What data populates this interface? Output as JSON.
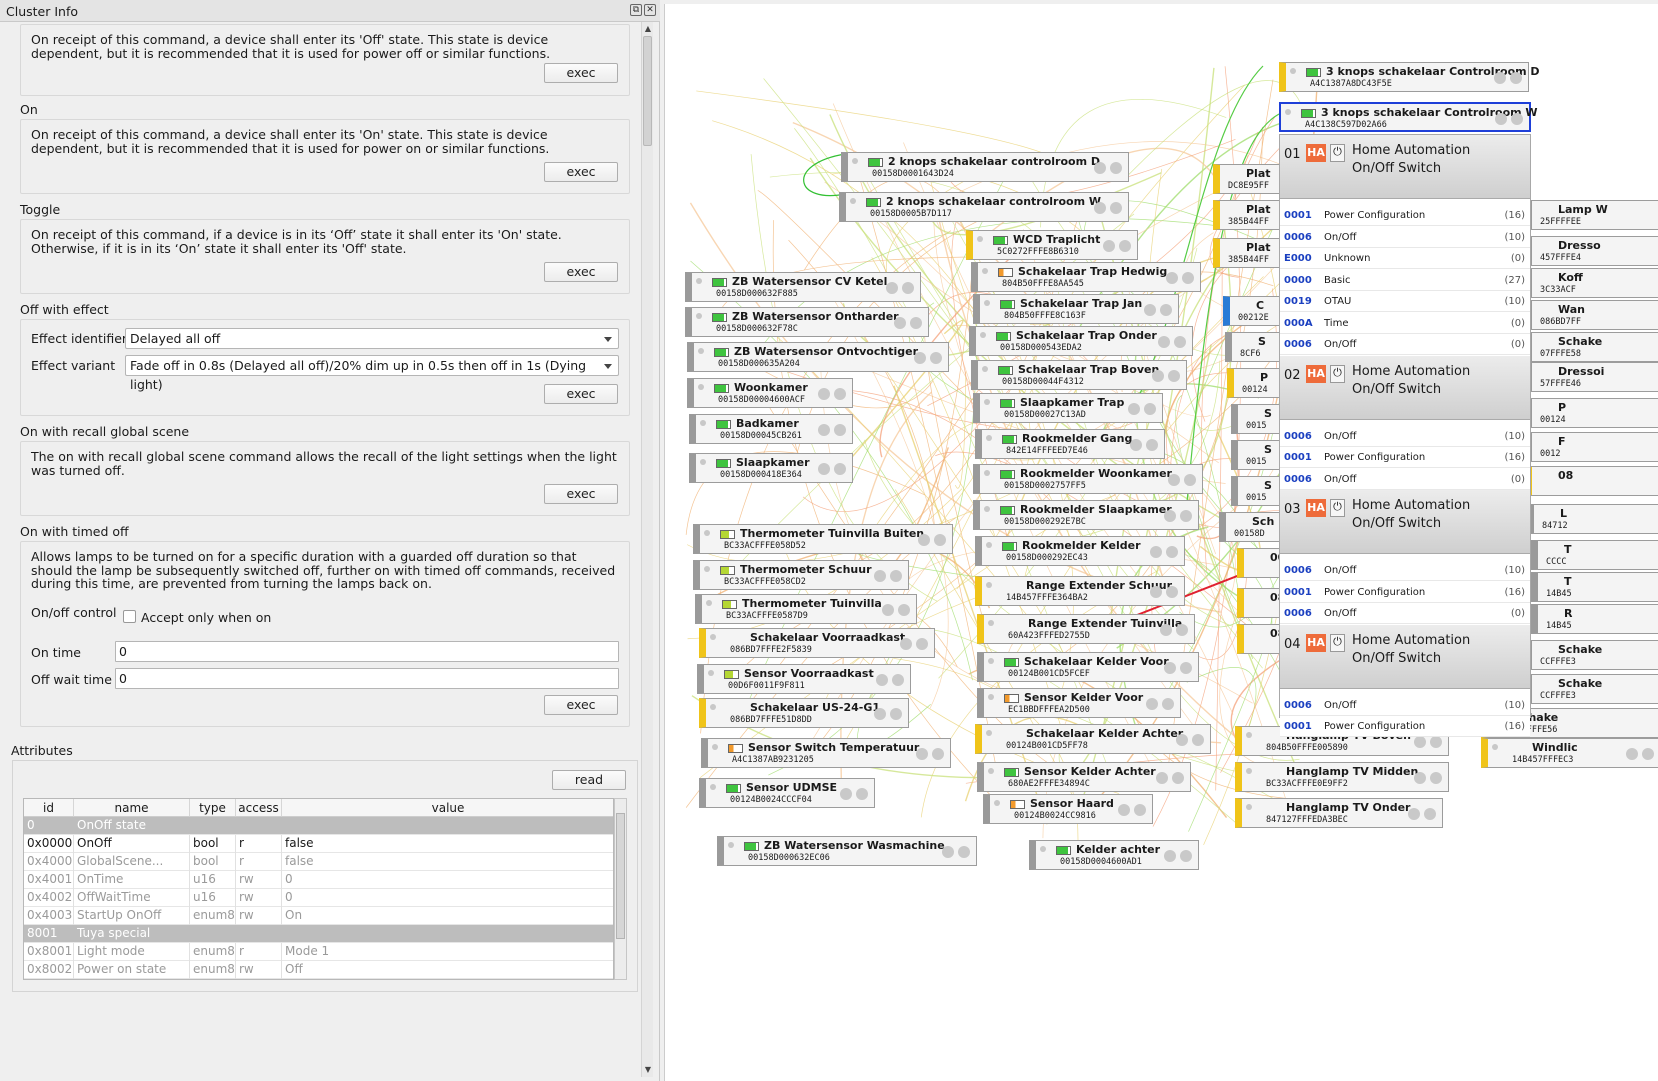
{
  "panel": {
    "title": "Cluster Info",
    "btn_float": "⧉",
    "btn_close": "✕",
    "commands": [
      {
        "label": "",
        "desc": "On receipt of this command, a device shall enter its 'Off' state. This state is device dependent, but it is recommended that it is used for power off or similar functions.",
        "exec": "exec"
      },
      {
        "label": "On",
        "desc": "On receipt of this command, a device shall enter its 'On' state. This state is device dependent, but it is recommended that it is used for power on or similar functions.",
        "exec": "exec"
      },
      {
        "label": "Toggle",
        "desc": "On receipt of this command, if a device is in its ‘Off’ state it shall enter its 'On' state. Otherwise, if it is in its ‘On’ state it shall enter its 'Off' state.",
        "exec": "exec"
      }
    ],
    "off_with_effect": {
      "label": "Off with effect",
      "effect_identifier_label": "Effect identifier",
      "effect_identifier_value": "Delayed all off",
      "effect_variant_label": "Effect variant",
      "effect_variant_value": "Fade off in 0.8s (Delayed all off)/20% dim up in 0.5s then off in 1s (Dying light)",
      "exec": "exec"
    },
    "recall_scene": {
      "label": "On with recall global scene",
      "desc": "The on with recall global scene command allows the recall of the light settings when the light was turned off.",
      "exec": "exec"
    },
    "timed_off": {
      "label": "On with timed off",
      "desc": "Allows lamps to be turned on for a specific duration with a guarded off duration so that should the lamp be subsequently switched off, further on with timed off commands, received during this time, are prevented from turning the lamps back on.",
      "onoff_control_label": "On/off control",
      "accept_label": "Accept only when on",
      "on_time_label": "On time",
      "on_time_value": "0",
      "off_wait_label": "Off wait time",
      "off_wait_value": "0",
      "exec": "exec"
    },
    "attributes": {
      "label": "Attributes",
      "read": "read",
      "columns": [
        "id",
        "name",
        "type",
        "access",
        "value"
      ],
      "rows": [
        {
          "group": true,
          "id": "0",
          "name": "OnOff state"
        },
        {
          "id": "0x0000",
          "name": "OnOff",
          "type": "bool",
          "access": "r",
          "value": "false"
        },
        {
          "id": "0x4000",
          "name": "GlobalScene...",
          "type": "bool",
          "access": "r",
          "value": "false",
          "dis": true
        },
        {
          "id": "0x4001",
          "name": "OnTime",
          "type": "u16",
          "access": "rw",
          "value": "0",
          "dis": true
        },
        {
          "id": "0x4002",
          "name": "OffWaitTime",
          "type": "u16",
          "access": "rw",
          "value": "0",
          "dis": true
        },
        {
          "id": "0x4003",
          "name": "StartUp OnOff",
          "type": "enum8",
          "access": "rw",
          "value": "On",
          "dis": true
        },
        {
          "group": true,
          "id": "8001",
          "name": "Tuya special"
        },
        {
          "id": "0x8001",
          "name": "Light mode",
          "type": "enum8",
          "access": "r",
          "value": "Mode 1",
          "dis": true
        },
        {
          "id": "0x8002",
          "name": "Power on state",
          "type": "enum8",
          "access": "rw",
          "value": "Off",
          "dis": true
        }
      ]
    }
  },
  "graph": {
    "nodes": [
      {
        "name": "3 knops schakelaar Controlroom D",
        "mac": "A4C1387A8DC43F5E"
      },
      {
        "name": "3 knops schakelaar Controlroom W",
        "mac": "A4C138C597D02A66"
      },
      {
        "name": "2 knops schakelaar controlroom D",
        "mac": "00158D0001643D24"
      },
      {
        "name": "2 knops schakelaar controlroom W",
        "mac": "00158D0005B7D117"
      },
      {
        "name": "WCD Traplicht",
        "mac": "5C0272FFFE8B6310"
      },
      {
        "name": "ZB Watersensor CV Ketel",
        "mac": "00158D000632F885"
      },
      {
        "name": "Schakelaar Trap Hedwig",
        "mac": "804B50FFFE8AA545"
      },
      {
        "name": "ZB Watersensor Ontharder",
        "mac": "00158D000632F78C"
      },
      {
        "name": "Schakelaar Trap Jan",
        "mac": "804B50FFFE8C163F"
      },
      {
        "name": "Schakelaar Trap Onder",
        "mac": "00158D000543EDA2"
      },
      {
        "name": "ZB Watersensor Ontvochtiger",
        "mac": "00158D000635A204"
      },
      {
        "name": "Schakelaar Trap Boven",
        "mac": "00158D00044F4312"
      },
      {
        "name": "Woonkamer",
        "mac": "00158D00004600ACF"
      },
      {
        "name": "Slaapkamer Trap",
        "mac": "00158D00027C13AD"
      },
      {
        "name": "Badkamer",
        "mac": "00158D00045CB261"
      },
      {
        "name": "Rookmelder Gang",
        "mac": "842E14FFFEED7E46"
      },
      {
        "name": "Slaapkamer",
        "mac": "00158D000418E364"
      },
      {
        "name": "Rookmelder Woonkamer",
        "mac": "00158D0002757FF5"
      },
      {
        "name": "Rookmelder Slaapkamer",
        "mac": "00158D000292E7BC"
      },
      {
        "name": "Thermometer Tuinvilla Buiten",
        "mac": "BC33ACFFFE058D52"
      },
      {
        "name": "Rookmelder Kelder",
        "mac": "00158D000292EC43"
      },
      {
        "name": "Thermometer Schuur",
        "mac": "BC33ACFFFE058CD2"
      },
      {
        "name": "Range Extender Schuur",
        "mac": "14B457FFFE364BA2"
      },
      {
        "name": "Thermometer Tuinvilla",
        "mac": "BC33ACFFFE0587D9"
      },
      {
        "name": "Range Extender Tuinvilla",
        "mac": "60A423FFFED2755D"
      },
      {
        "name": "Schakelaar Voorraadkast",
        "mac": "086BD7FFFE2F5839"
      },
      {
        "name": "Schakelaar Kelder Voor",
        "mac": "00124B001CD5FCEF"
      },
      {
        "name": "Sensor Voorraadkast",
        "mac": "00D6F0011F9F811"
      },
      {
        "name": "Sensor Kelder Voor",
        "mac": "EC1BBDFFFEA2D500"
      },
      {
        "name": "Schakelaar US-24-G1",
        "mac": "086BD7FFFE51D8DD"
      },
      {
        "name": "Schakelaar Kelder Achter",
        "mac": "00124B001CD5FF78"
      },
      {
        "name": "Sensor Switch Temperatuur",
        "mac": "A4C1387AB9231205"
      },
      {
        "name": "Sensor Kelder Achter",
        "mac": "680AE2FFFE34894C"
      },
      {
        "name": "Sensor UDMSE",
        "mac": "00124B0024CCCF04"
      },
      {
        "name": "Sensor Haard",
        "mac": "00124B0024CC9816"
      },
      {
        "name": "ZB Watersensor Wasmachine",
        "mac": "00158D000632EC06"
      },
      {
        "name": "Kelder achter",
        "mac": "00158D0004600AD1"
      },
      {
        "name": "Hanglamp TV Boven",
        "mac": "804B50FFFE005890"
      },
      {
        "name": "Hanglamp TV Midden",
        "mac": "BC33ACFFFE0E9FF2"
      },
      {
        "name": "Hanglamp TV Onder",
        "mac": "847127FFFEDA3BEC"
      },
      {
        "name": "Windlic",
        "mac": "14B457FFFEC3"
      }
    ],
    "partial_nodes": [
      "Plat",
      "DC8E95FF",
      "Plat",
      "385B44FF",
      "Plat",
      "385B44FF",
      "C",
      "00212E",
      "S",
      "8CF6",
      "P",
      "00124",
      "S",
      "0015",
      "S",
      "0015",
      "S",
      "0015",
      "Sch",
      "00158D",
      "0015",
      "086",
      "086",
      "Lamp W",
      "25FFFFEE",
      "Dresso",
      "457FFFE4",
      "Koff",
      "3C33ACF",
      "Wan",
      "086BD7FF",
      "Schake",
      "07FFFE58",
      "Dressoi",
      "57FFFE46",
      "P",
      "00124",
      "F",
      "0012",
      "08",
      "L",
      "84712",
      "T",
      "CCCC",
      "T",
      "14B45",
      "R",
      "14B45",
      "Schake",
      "CCFFFE3",
      "Schake",
      "CCFFFE3",
      "Schake",
      "086BD7FFFE56"
    ],
    "popup": {
      "endpoints": [
        {
          "no": "01",
          "badge": "HA",
          "title1": "Home Automation",
          "title2": "On/Off Switch",
          "clusters": [
            {
              "id": "0001",
              "name": "Power Configuration",
              "count": "(16)"
            },
            {
              "id": "0006",
              "name": "On/Off",
              "count": "(10)"
            },
            {
              "id": "E000",
              "name": "Unknown",
              "count": "(0)"
            },
            {
              "id": "0000",
              "name": "Basic",
              "count": "(27)"
            },
            {
              "id": "0019",
              "name": "OTAU",
              "count": "(10)"
            },
            {
              "id": "000A",
              "name": "Time",
              "count": "(0)"
            },
            {
              "id": "0006",
              "name": "On/Off",
              "count": "(0)"
            }
          ]
        },
        {
          "no": "02",
          "badge": "HA",
          "title1": "Home Automation",
          "title2": "On/Off Switch",
          "clusters": [
            {
              "id": "0006",
              "name": "On/Off",
              "count": "(10)"
            },
            {
              "id": "0001",
              "name": "Power Configuration",
              "count": "(16)"
            },
            {
              "id": "0006",
              "name": "On/Off",
              "count": "(0)"
            }
          ]
        },
        {
          "no": "03",
          "badge": "HA",
          "title1": "Home Automation",
          "title2": "On/Off Switch",
          "clusters": [
            {
              "id": "0006",
              "name": "On/Off",
              "count": "(10)"
            },
            {
              "id": "0001",
              "name": "Power Configuration",
              "count": "(16)"
            },
            {
              "id": "0006",
              "name": "On/Off",
              "count": "(0)"
            }
          ]
        },
        {
          "no": "04",
          "badge": "HA",
          "title1": "Home Automation",
          "title2": "On/Off Switch",
          "clusters": [
            {
              "id": "0006",
              "name": "On/Off",
              "count": "(10)"
            },
            {
              "id": "0001",
              "name": "Power Configuration",
              "count": "(16)"
            }
          ]
        }
      ]
    }
  }
}
